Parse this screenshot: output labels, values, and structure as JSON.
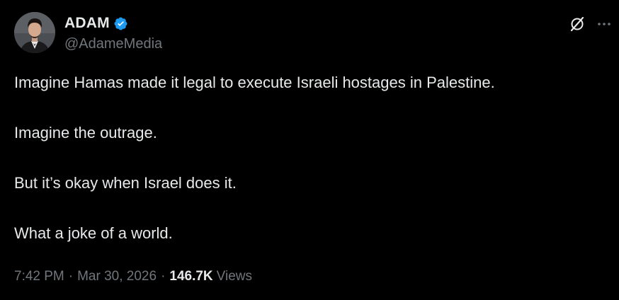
{
  "author": {
    "name": "ADAM",
    "handle": "@AdameMedia",
    "verified": true
  },
  "tweet": {
    "paragraphs": [
      "Imagine Hamas made it legal to execute Israeli hostages in Palestine.",
      "Imagine the outrage.",
      "But it’s okay when Israel does it.",
      "What a joke of a world."
    ]
  },
  "meta": {
    "time": "7:42 PM",
    "separator": "·",
    "date": "Mar 30, 2026",
    "views_count": "146.7K",
    "views_label": "Views"
  },
  "icons": {
    "verified": "verified-badge-icon",
    "grok": "grok-icon",
    "more": "more-options-icon"
  },
  "colors": {
    "background": "#000000",
    "primary_text": "#e7e9ea",
    "secondary_text": "#71767b",
    "verified_blue": "#1d9bf0"
  }
}
